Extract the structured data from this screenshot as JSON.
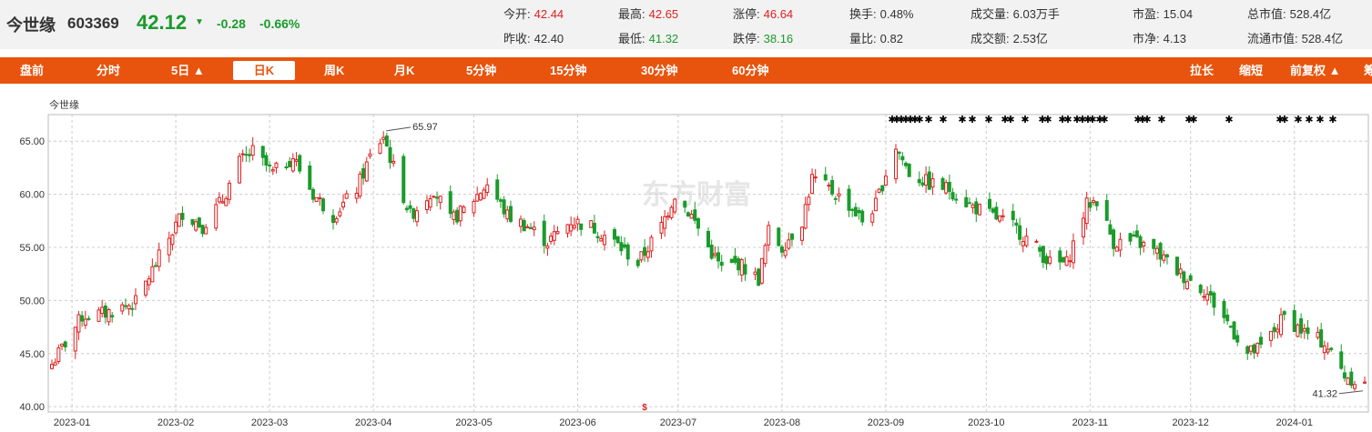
{
  "header": {
    "name": "今世缘",
    "code": "603369",
    "price": "42.12",
    "arrow": "▼",
    "change": "-0.28",
    "change_pct": "-0.66%",
    "quotes": [
      {
        "label": "今开:",
        "value": "42.44",
        "color": "red"
      },
      {
        "label": "昨收:",
        "value": "42.40",
        "color": "dark"
      },
      {
        "label": "最高:",
        "value": "42.65",
        "color": "red"
      },
      {
        "label": "最低:",
        "value": "41.32",
        "color": "green"
      },
      {
        "label": "涨停:",
        "value": "46.64",
        "color": "red"
      },
      {
        "label": "跌停:",
        "value": "38.16",
        "color": "green"
      },
      {
        "label": "换手:",
        "value": "0.48%",
        "color": "dark"
      },
      {
        "label": "量比:",
        "value": "0.82",
        "color": "dark"
      },
      {
        "label": "成交量:",
        "value": "6.03万手",
        "color": "dark"
      },
      {
        "label": "成交额:",
        "value": "2.53亿",
        "color": "dark"
      },
      {
        "label": "市盈:",
        "value": "15.04",
        "color": "dark"
      },
      {
        "label": "市净:",
        "value": "4.13",
        "color": "dark"
      },
      {
        "label": "总市值:",
        "value": "528.4亿",
        "color": "dark"
      },
      {
        "label": "流通市值:",
        "value": "528.4亿",
        "color": "dark"
      }
    ]
  },
  "tabs": {
    "left": [
      "盘前",
      "分时",
      "5日 ▲",
      "日K",
      "周K",
      "月K",
      "5分钟",
      "15分钟",
      "30分钟",
      "60分钟"
    ],
    "active": "日K",
    "right": [
      "拉长",
      "缩短",
      "前复权 ▲",
      "筹"
    ]
  },
  "colors": {
    "up": "#e02020",
    "down": "#1a9b2b",
    "brand": "#e8540d"
  },
  "chart_data": {
    "type": "candlestick",
    "title": "今世缘",
    "watermark": "东方财富",
    "y_ticks": [
      "65.00",
      "60.00",
      "55.00",
      "50.00",
      "45.00",
      "40.00"
    ],
    "ylim": [
      39.5,
      67.5
    ],
    "x_ticks": [
      "2023-01",
      "2023-02",
      "2023-03",
      "2023-04",
      "2023-05",
      "2023-06",
      "2023-07",
      "2023-08",
      "2023-09",
      "2023-10",
      "2023-11",
      "2023-12",
      "2024-01"
    ],
    "high_label": "65.97",
    "low_label": "41.32",
    "grid": true,
    "path_closes": [
      [
        "2022-12-26",
        44.0
      ],
      [
        "2022-12-30",
        46.0
      ],
      [
        "2023-01-04",
        48.5
      ],
      [
        "2023-01-11",
        48.8
      ],
      [
        "2023-01-17",
        49.5
      ],
      [
        "2023-01-20",
        49.8
      ],
      [
        "2023-01-31",
        56.5
      ],
      [
        "2023-02-03",
        58.3
      ],
      [
        "2023-02-09",
        57.0
      ],
      [
        "2023-02-15",
        59.5
      ],
      [
        "2023-02-20",
        63.0
      ],
      [
        "2023-02-24",
        64.0
      ],
      [
        "2023-03-02",
        62.0
      ],
      [
        "2023-03-08",
        63.5
      ],
      [
        "2023-03-14",
        60.0
      ],
      [
        "2023-03-20",
        58.0
      ],
      [
        "2023-03-27",
        60.5
      ],
      [
        "2023-03-31",
        63.5
      ],
      [
        "2023-04-04",
        65.5
      ],
      [
        "2023-04-07",
        62.5
      ],
      [
        "2023-04-12",
        58.0
      ],
      [
        "2023-04-19",
        60.5
      ],
      [
        "2023-04-24",
        57.5
      ],
      [
        "2023-04-28",
        58.5
      ],
      [
        "2023-05-05",
        61.0
      ],
      [
        "2023-05-11",
        58.0
      ],
      [
        "2023-05-17",
        57.0
      ],
      [
        "2023-05-23",
        55.5
      ],
      [
        "2023-05-30",
        57.5
      ],
      [
        "2023-06-05",
        57.0
      ],
      [
        "2023-06-12",
        55.5
      ],
      [
        "2023-06-19",
        53.5
      ],
      [
        "2023-06-26",
        57.0
      ],
      [
        "2023-06-30",
        60.0
      ],
      [
        "2023-07-05",
        58.0
      ],
      [
        "2023-07-10",
        55.0
      ],
      [
        "2023-07-14",
        53.0
      ],
      [
        "2023-07-19",
        53.5
      ],
      [
        "2023-07-25",
        52.0
      ],
      [
        "2023-07-28",
        56.5
      ],
      [
        "2023-08-01",
        55.0
      ],
      [
        "2023-08-07",
        57.5
      ],
      [
        "2023-08-10",
        61.5
      ],
      [
        "2023-08-15",
        60.5
      ],
      [
        "2023-08-21",
        59.0
      ],
      [
        "2023-08-25",
        57.5
      ],
      [
        "2023-08-29",
        59.0
      ],
      [
        "2023-09-01",
        62.0
      ],
      [
        "2023-09-04",
        64.5
      ],
      [
        "2023-09-08",
        62.0
      ],
      [
        "2023-09-14",
        61.0
      ],
      [
        "2023-09-20",
        60.5
      ],
      [
        "2023-09-26",
        59.0
      ],
      [
        "2023-10-09",
        57.0
      ],
      [
        "2023-10-16",
        55.0
      ],
      [
        "2023-10-20",
        53.5
      ],
      [
        "2023-10-25",
        53.5
      ],
      [
        "2023-10-31",
        59.0
      ],
      [
        "2023-11-03",
        59.5
      ],
      [
        "2023-11-08",
        55.5
      ],
      [
        "2023-11-15",
        55.5
      ],
      [
        "2023-11-21",
        54.5
      ],
      [
        "2023-11-28",
        52.5
      ],
      [
        "2023-12-05",
        51.0
      ],
      [
        "2023-12-12",
        48.0
      ],
      [
        "2023-12-18",
        45.0
      ],
      [
        "2023-12-22",
        45.5
      ],
      [
        "2023-12-29",
        48.5
      ],
      [
        "2024-01-04",
        47.0
      ],
      [
        "2024-01-10",
        46.0
      ],
      [
        "2024-01-16",
        43.0
      ],
      [
        "2024-01-19",
        42.5
      ],
      [
        "2024-01-22",
        42.12
      ]
    ]
  }
}
